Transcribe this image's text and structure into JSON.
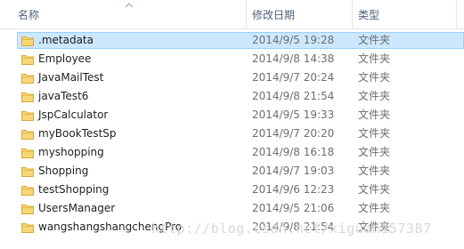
{
  "columns": {
    "name": "名称",
    "modified": "修改日期",
    "type": "类型"
  },
  "files": [
    {
      "name": ".metadata",
      "modified": "2014/9/5 19:28",
      "type": "文件夹",
      "selected": true
    },
    {
      "name": "Employee",
      "modified": "2014/9/8 14:38",
      "type": "文件夹"
    },
    {
      "name": "JavaMailTest",
      "modified": "2014/9/7 20:24",
      "type": "文件夹"
    },
    {
      "name": "javaTest6",
      "modified": "2014/9/8 21:54",
      "type": "文件夹"
    },
    {
      "name": "JspCalculator",
      "modified": "2014/9/5 19:33",
      "type": "文件夹"
    },
    {
      "name": "myBookTestSp",
      "modified": "2014/9/7 20:20",
      "type": "文件夹"
    },
    {
      "name": "myshopping",
      "modified": "2014/9/8 16:18",
      "type": "文件夹"
    },
    {
      "name": "Shopping",
      "modified": "2014/9/7 19:03",
      "type": "文件夹"
    },
    {
      "name": "testShopping",
      "modified": "2014/9/6 12:23",
      "type": "文件夹"
    },
    {
      "name": "UsersManager",
      "modified": "2014/9/5 21:06",
      "type": "文件夹"
    },
    {
      "name": "wangshangshangchengPro",
      "modified": "2014/9/8 21:54",
      "type": "文件夹"
    }
  ],
  "watermark": "http://blog.csdn.net/xiguan157387",
  "colors": {
    "selection_bg": "#cce8ff",
    "selection_border": "#99d1ff",
    "folder": "#f4c74d"
  },
  "icons": {
    "folder": "folder-icon",
    "sort": "sort-ascending-icon"
  }
}
